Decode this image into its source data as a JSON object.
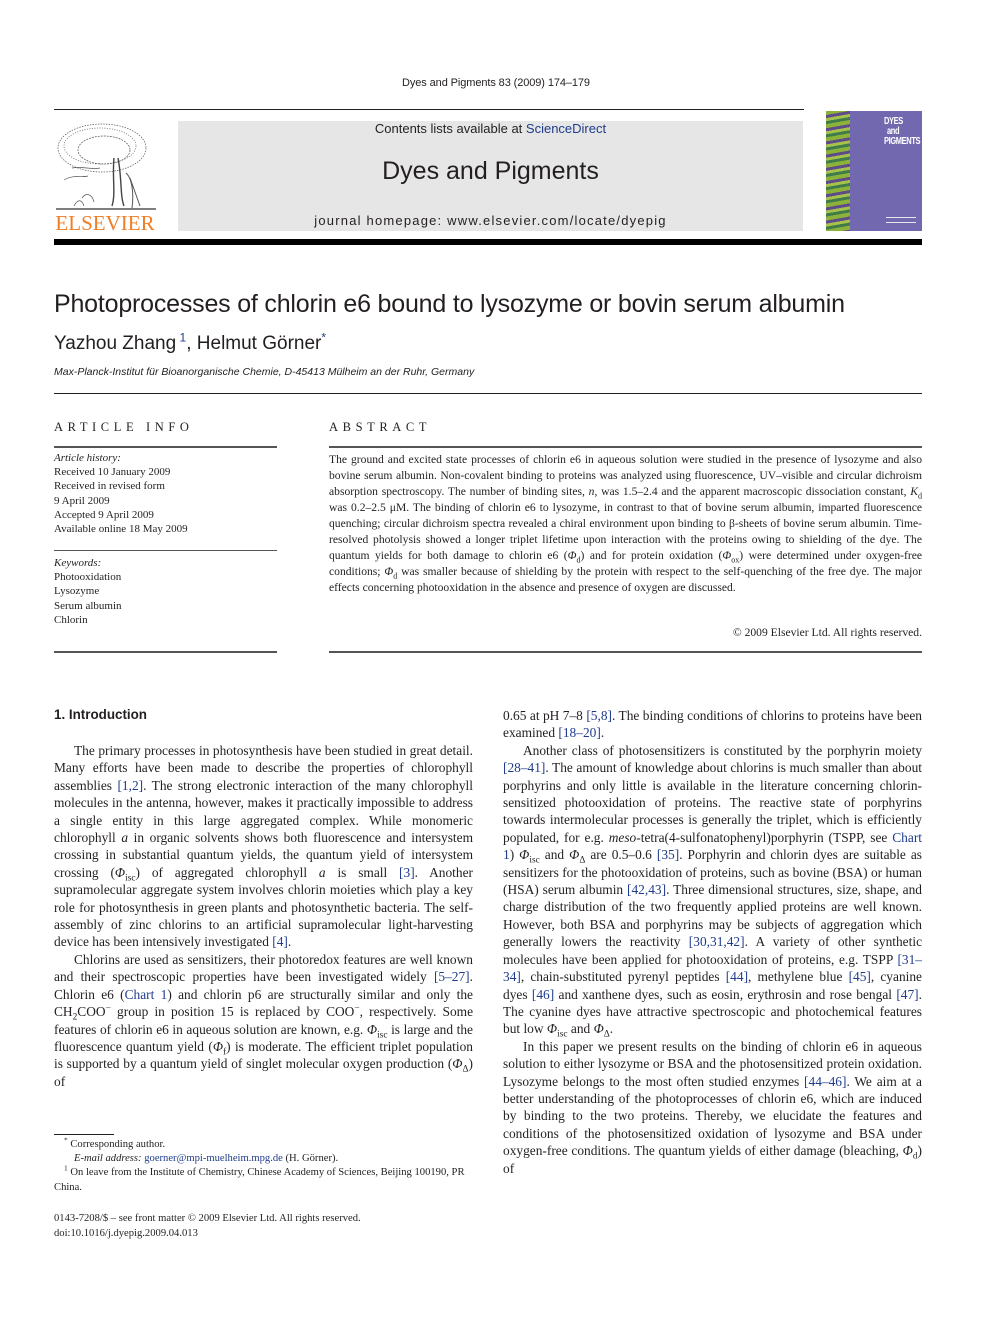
{
  "header": {
    "running_head": "Dyes and Pigments 83 (2009) 174–179",
    "contents_prefix": "Contents lists available at ",
    "contents_link": "ScienceDirect",
    "journal_name": "Dyes and Pigments",
    "homepage": "journal homepage: www.elsevier.com/locate/dyepig",
    "publisher_logo_text": "ELSEVIER",
    "cover_title_lines": [
      "DYES",
      "and",
      "PIGMENTS"
    ],
    "colors": {
      "elsevier_orange": "#f07e26",
      "masthead_gray": "#e6e6e6",
      "link_blue": "#1f3c8c",
      "cover_purple": "#7268b0"
    }
  },
  "article": {
    "title": "Photoprocesses of chlorin e6 bound to lysozyme or bovin serum albumin",
    "authors": [
      {
        "name": "Yazhou Zhang",
        "mark": "1"
      },
      {
        "name": "Helmut Görner",
        "mark": "*"
      }
    ],
    "author_separator": ", ",
    "affiliation": "Max-Planck-Institut für Bioanorganische Chemie, D-45413 Mülheim an der Ruhr, Germany"
  },
  "article_info": {
    "heading": "ARTICLE INFO",
    "history_label": "Article history:",
    "history": [
      "Received 10 January 2009",
      "Received in revised form",
      "9 April 2009",
      "Accepted 9 April 2009",
      "Available online 18 May 2009"
    ],
    "keywords_label": "Keywords:",
    "keywords": [
      "Photooxidation",
      "Lysozyme",
      "Serum albumin",
      "Chlorin"
    ]
  },
  "abstract": {
    "heading": "ABSTRACT",
    "parts": {
      "a": "The ground and excited state processes of chlorin e6 in aqueous solution were studied in the presence of lysozyme and also bovine serum albumin. Non-covalent binding to proteins was analyzed using fluorescence, UV–visible and circular dichroism absorption spectroscopy. The number of binding sites, ",
      "n": "n",
      "b": ", was 1.5–2.4 and the apparent macroscopic dissociation constant, ",
      "K": "K",
      "Ksub": "d",
      "c": " was 0.2–2.5 μM. The binding of chlorin e6 to lysozyme, in contrast to that of bovine serum albumin, imparted fluorescence quenching; circular dichroism spectra revealed a chiral environment upon binding to β-sheets of bovine serum albumin. Time-resolved photolysis showed a longer triplet lifetime upon interaction with the proteins owing to shielding of the dye. The quantum yields for both damage to chlorin e6 (",
      "phi": "Φ",
      "d": "d",
      "e": ") and for protein oxidation (",
      "ox": "ox",
      "f": ") were determined under oxygen-free conditions; ",
      "g": " was smaller because of shielding by the protein with respect to the self-quenching of the free dye. The major effects concerning photooxidation in the absence and presence of oxygen are discussed."
    },
    "copyright": "© 2009 Elsevier Ltd. All rights reserved."
  },
  "body": {
    "section_heading": "1.  Introduction",
    "left": {
      "p1": [
        "The primary processes in photosynthesis have been studied in great detail. Many efforts have been made to describe the properties of chlorophyll assemblies ",
        "[1,2]",
        ". The strong electronic interaction of the many chlorophyll molecules in the antenna, however, makes it practically impossible to address a single entity in this large aggregated complex. While monomeric chlorophyll ",
        "a",
        " in organic solvents shows both fluorescence and intersystem crossing in substantial quantum yields, the quantum yield of intersystem crossing (",
        "Φ",
        "isc",
        ") of aggregated chlorophyll ",
        "a",
        " is small ",
        "[3]",
        ". Another supramolecular aggregate system involves chlorin moieties which play a key role for photosynthesis in green plants and photosynthetic bacteria. The self-assembly of zinc chlorins to an artificial supramolecular light-harvesting device has been intensively investigated ",
        "[4]",
        "."
      ],
      "p2": [
        "Chlorins are used as sensitizers, their photoredox features are well known and their spectroscopic properties have been investigated widely ",
        "[5–27]",
        ". Chlorin e6 (",
        "Chart 1",
        ") and chlorin p6 are structurally similar and only the CH",
        "2",
        "COO",
        "−",
        " group in position 15 is replaced by COO",
        "−",
        ", respectively. Some features of chlorin e6 in aqueous solution are known, e.g. ",
        "Φ",
        "isc",
        " is large and the fluorescence quantum yield (",
        "Φ",
        "f",
        ") is moderate. The efficient triplet population is supported by a quantum yield of singlet molecular oxygen production (",
        "Φ",
        "Δ",
        ") of"
      ]
    },
    "right": {
      "p1": [
        "0.65 at pH 7–8 ",
        "[5,8]",
        ". The binding conditions of chlorins to proteins have been examined ",
        "[18–20]",
        "."
      ],
      "p2": [
        "Another class of photosensitizers is constituted by the porphyrin moiety ",
        "[28–41]",
        ". The amount of knowledge about chlorins is much smaller than about porphyrins and only little is available in the literature concerning chlorin-sensitized photooxidation of proteins. The reactive state of porphyrins towards intermolecular processes is generally the triplet, which is efficiently populated, for e.g. ",
        "meso",
        "-tetra(4-sulfonatophenyl)porphyrin (TSPP, see ",
        "Chart 1",
        ") ",
        "Φ",
        "isc",
        " and ",
        "Φ",
        "Δ",
        " are 0.5–0.6 ",
        "[35]",
        ". Porphyrin and chlorin dyes are suitable as sensitizers for the photooxidation of proteins, such as bovine (BSA) or human (HSA) serum albumin ",
        "[42,43]",
        ". Three dimensional structures, size, shape, and charge distribution of the two frequently applied proteins are well known. However, both BSA and porphyrins may be subjects of aggregation which generally lowers the reactivity ",
        "[30,31,42]",
        ". A variety of other synthetic molecules have been applied for photooxidation of proteins, e.g. TSPP ",
        "[31–34]",
        ", chain-substituted pyrenyl peptides ",
        "[44]",
        ", methylene blue ",
        "[45]",
        ", cyanine dyes ",
        "[46]",
        " and xanthene dyes, such as eosin, erythrosin and rose bengal ",
        "[47]",
        ". The cyanine dyes have attractive spectroscopic and photochemical features but low ",
        "Φ",
        "isc",
        " and ",
        "Φ",
        "Δ",
        "."
      ],
      "p3": [
        "In this paper we present results on the binding of chlorin e6 in aqueous solution to either lysozyme or BSA and the photosensitized protein oxidation. Lysozyme belongs to the most often studied enzymes ",
        "[44–46]",
        ". We aim at a better understanding of the photoprocesses of chlorin e6, which are induced by binding to the two proteins. Thereby, we elucidate the features and conditions of the photosensitized oxidation of lysozyme and BSA under oxygen-free conditions. The quantum yields of either damage (bleaching, ",
        "Φ",
        "d",
        ") of"
      ]
    }
  },
  "footnotes": {
    "corresponding_mark": "*",
    "corresponding": "Corresponding author.",
    "email_label": "E-mail address:",
    "email": "goerner@mpi-muelheim.mpg.de",
    "email_suffix": " (H. Görner).",
    "note1_mark": "1",
    "note1": "On leave from the Institute of Chemistry, Chinese Academy of Sciences, Beijing 100190, PR China."
  },
  "front_matter": {
    "issn": "0143-7208/$ – see front matter © 2009 Elsevier Ltd. All rights reserved.",
    "doi": "doi:10.1016/j.dyepig.2009.04.013"
  }
}
